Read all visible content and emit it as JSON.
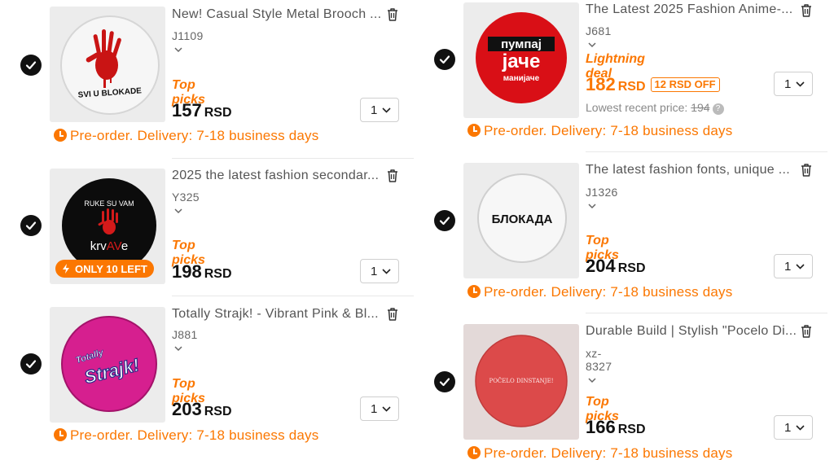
{
  "colors": {
    "accent": "#fb7701",
    "check": "#111111"
  },
  "left_items": [
    {
      "title": "New! Casual Style Metal Brooch ...",
      "sku": "J1109",
      "tag": "Top picks",
      "price": "157",
      "currency": "RSD",
      "qty": "1",
      "delivery": "Pre-order. Delivery: 7-18 business days",
      "image_text": "SVI U BLOKADE"
    },
    {
      "title": "2025 the latest fashion secondar...",
      "sku": "Y325",
      "tag": "Top picks",
      "price": "198",
      "currency": "RSD",
      "qty": "1",
      "badge": "ONLY 10 LEFT",
      "image_text_top": "RUKE SU VAM",
      "image_text_bottom_a": "krv",
      "image_text_bottom_b": "AV",
      "image_text_bottom_c": "e"
    },
    {
      "title": "Totally Strajk! - Vibrant Pink & Bl...",
      "sku": "J881",
      "tag": "Top picks",
      "price": "203",
      "currency": "RSD",
      "qty": "1",
      "delivery": "Pre-order. Delivery: 7-18 business days",
      "image_text_a": "Totally",
      "image_text_b": "Strajk!"
    }
  ],
  "right_items": [
    {
      "title": "The Latest 2025 Fashion Anime-...",
      "sku": "J681",
      "tag": "Lightning deal",
      "price": "182",
      "currency": "RSD",
      "off": "12 RSD OFF",
      "lowest_label": "Lowest recent price:",
      "lowest_value": "194",
      "qty": "1",
      "delivery": "Pre-order. Delivery: 7-18 business days",
      "image_text_a": "пумпај",
      "image_text_b": "јаче",
      "image_text_c": "манијаче"
    },
    {
      "title": "The latest fashion fonts, unique ...",
      "sku": "J1326",
      "tag": "Top picks",
      "price": "204",
      "currency": "RSD",
      "qty": "1",
      "delivery": "Pre-order. Delivery: 7-18 business days",
      "image_text": "БЛОКАДА"
    },
    {
      "title": "Durable Build | Stylish \"Pocelo Di...",
      "sku": "xz-8327",
      "tag": "Top picks",
      "price": "166",
      "currency": "RSD",
      "qty": "1",
      "delivery": "Pre-order. Delivery: 7-18 business days",
      "image_text": "POČELO DINSTANJE!"
    }
  ]
}
